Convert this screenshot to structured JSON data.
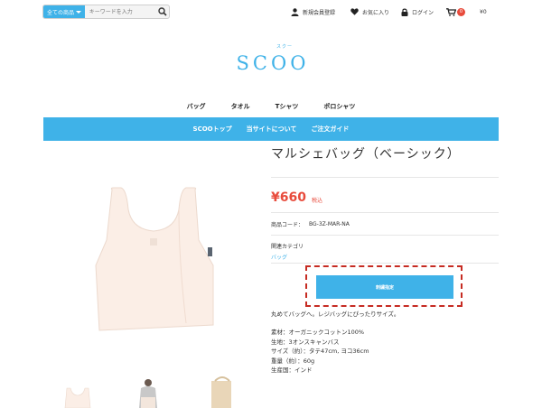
{
  "header": {
    "search": {
      "category_label": "全ての商品",
      "placeholder": "キーワードを入力"
    },
    "nav": {
      "register": "新規会員登録",
      "favorites": "お気に入り",
      "login": "ログイン",
      "cart_count": "0",
      "cart_total": "¥0"
    }
  },
  "logo": {
    "ruby": "スクー",
    "text": "SCOO"
  },
  "category_nav": [
    "バッグ",
    "タオル",
    "Tシャツ",
    "ポロシャツ"
  ],
  "blue_nav": [
    "SCOOトップ",
    "当サイトについて",
    "ご注文ガイド"
  ],
  "product": {
    "title": "マルシェバッグ（ベーシック）",
    "price": "¥660",
    "tax_label": "税込",
    "code_label": "商品コード：",
    "code": "BG-3Z-MAR-NA",
    "category_label": "関連カテゴリ",
    "category_link": "バッグ",
    "button_label": "刺繍指定",
    "description": "丸めてバッグへ。レジバッグにぴったりサイズ。",
    "specs": [
      "素材：オーガニックコットン100%",
      "生地：3オンスキャンバス",
      "サイズ（約）：タテ47cm, ヨコ36cm",
      "重量（約）：60g",
      "生産国：インド"
    ]
  },
  "colors": {
    "accent": "#3fb2e8",
    "price": "#e84b3c",
    "highlight": "#c62b22"
  }
}
